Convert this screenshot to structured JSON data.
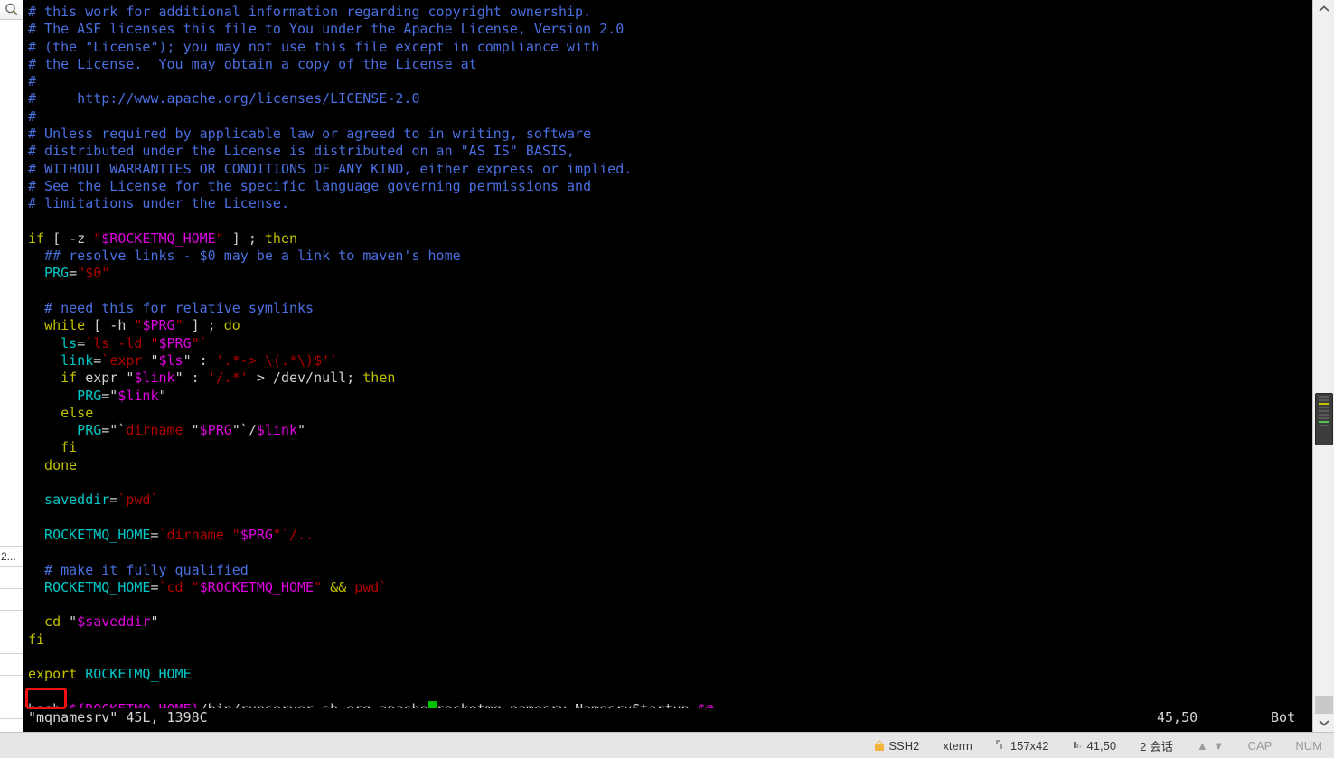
{
  "sidebar": {
    "search_icon": "magnifier-icon",
    "rows": [
      {
        "label": "2..."
      },
      {
        "label": ""
      },
      {
        "label": ""
      },
      {
        "label": ""
      },
      {
        "label": ""
      },
      {
        "label": ""
      },
      {
        "label": ""
      },
      {
        "label": ""
      }
    ]
  },
  "terminal": {
    "lines": [
      {
        "segs": [
          {
            "t": "# this work for additional information regarding copyright ownership.",
            "c": "c-comment"
          }
        ]
      },
      {
        "segs": [
          {
            "t": "# The ASF licenses this file to You under the Apache License, Version 2.0",
            "c": "c-comment"
          }
        ]
      },
      {
        "segs": [
          {
            "t": "# (the \"License\"); you may not use this file except in compliance with",
            "c": "c-comment"
          }
        ]
      },
      {
        "segs": [
          {
            "t": "# the License.  You may obtain a copy of the License at",
            "c": "c-comment"
          }
        ]
      },
      {
        "segs": [
          {
            "t": "#",
            "c": "c-comment"
          }
        ]
      },
      {
        "segs": [
          {
            "t": "#     http://www.apache.org/licenses/LICENSE-2.0",
            "c": "c-comment"
          }
        ]
      },
      {
        "segs": [
          {
            "t": "#",
            "c": "c-comment"
          }
        ]
      },
      {
        "segs": [
          {
            "t": "# Unless required by applicable law or agreed to in writing, software",
            "c": "c-comment"
          }
        ]
      },
      {
        "segs": [
          {
            "t": "# distributed under the License is distributed on an \"AS IS\" BASIS,",
            "c": "c-comment"
          }
        ]
      },
      {
        "segs": [
          {
            "t": "# WITHOUT WARRANTIES OR CONDITIONS OF ANY KIND, either express or implied.",
            "c": "c-comment"
          }
        ]
      },
      {
        "segs": [
          {
            "t": "# See the License for the specific language governing permissions and",
            "c": "c-comment"
          }
        ]
      },
      {
        "segs": [
          {
            "t": "# limitations under the License.",
            "c": "c-comment"
          }
        ]
      },
      {
        "segs": [
          {
            "t": "",
            "c": "c-plain"
          }
        ]
      },
      {
        "segs": [
          {
            "t": "if",
            "c": "c-keyword"
          },
          {
            "t": " [ -z ",
            "c": "c-plain"
          },
          {
            "t": "\"",
            "c": "c-str"
          },
          {
            "t": "$ROCKETMQ_HOME",
            "c": "c-var"
          },
          {
            "t": "\"",
            "c": "c-str"
          },
          {
            "t": " ] ; ",
            "c": "c-plain"
          },
          {
            "t": "then",
            "c": "c-keyword"
          }
        ]
      },
      {
        "segs": [
          {
            "t": "  ## resolve links - $0 may be a link to maven's home",
            "c": "c-comment"
          }
        ]
      },
      {
        "segs": [
          {
            "t": "  PRG",
            "c": "c-ident"
          },
          {
            "t": "=",
            "c": "c-plain"
          },
          {
            "t": "\"",
            "c": "c-str"
          },
          {
            "t": "$0",
            "c": "c-str"
          },
          {
            "t": "\"",
            "c": "c-str"
          }
        ]
      },
      {
        "segs": [
          {
            "t": "",
            "c": "c-plain"
          }
        ]
      },
      {
        "segs": [
          {
            "t": "  # need this for relative symlinks",
            "c": "c-comment"
          }
        ]
      },
      {
        "segs": [
          {
            "t": "  while",
            "c": "c-keyword"
          },
          {
            "t": " [ -h ",
            "c": "c-plain"
          },
          {
            "t": "\"",
            "c": "c-str"
          },
          {
            "t": "$PRG",
            "c": "c-var"
          },
          {
            "t": "\"",
            "c": "c-str"
          },
          {
            "t": " ] ; ",
            "c": "c-plain"
          },
          {
            "t": "do",
            "c": "c-keyword"
          }
        ]
      },
      {
        "segs": [
          {
            "t": "    ls",
            "c": "c-ident"
          },
          {
            "t": "=",
            "c": "c-plain"
          },
          {
            "t": "`ls -ld ",
            "c": "c-str"
          },
          {
            "t": "\"",
            "c": "c-str"
          },
          {
            "t": "$PRG",
            "c": "c-var"
          },
          {
            "t": "\"`",
            "c": "c-str"
          }
        ]
      },
      {
        "segs": [
          {
            "t": "    link",
            "c": "c-ident"
          },
          {
            "t": "=",
            "c": "c-plain"
          },
          {
            "t": "`",
            "c": "c-str"
          },
          {
            "t": "expr",
            "c": "c-str"
          },
          {
            "t": " \"",
            "c": "c-plain"
          },
          {
            "t": "$ls",
            "c": "c-var"
          },
          {
            "t": "\" : ",
            "c": "c-plain"
          },
          {
            "t": "'.*-> \\(.*\\)$'`",
            "c": "c-str"
          }
        ]
      },
      {
        "segs": [
          {
            "t": "    if",
            "c": "c-keyword"
          },
          {
            "t": " expr \"",
            "c": "c-plain"
          },
          {
            "t": "$link",
            "c": "c-var"
          },
          {
            "t": "\" : ",
            "c": "c-plain"
          },
          {
            "t": "'/.*'",
            "c": "c-str"
          },
          {
            "t": " > /dev/null; ",
            "c": "c-plain"
          },
          {
            "t": "then",
            "c": "c-keyword"
          }
        ]
      },
      {
        "segs": [
          {
            "t": "      PRG",
            "c": "c-ident"
          },
          {
            "t": "=\"",
            "c": "c-plain"
          },
          {
            "t": "$link",
            "c": "c-var"
          },
          {
            "t": "\"",
            "c": "c-plain"
          }
        ]
      },
      {
        "segs": [
          {
            "t": "    else",
            "c": "c-keyword"
          }
        ]
      },
      {
        "segs": [
          {
            "t": "      PRG",
            "c": "c-ident"
          },
          {
            "t": "=\"`",
            "c": "c-plain"
          },
          {
            "t": "dirname",
            "c": "c-str"
          },
          {
            "t": " \"",
            "c": "c-plain"
          },
          {
            "t": "$PRG",
            "c": "c-var"
          },
          {
            "t": "\"`/",
            "c": "c-plain"
          },
          {
            "t": "$link",
            "c": "c-var"
          },
          {
            "t": "\"",
            "c": "c-plain"
          }
        ]
      },
      {
        "segs": [
          {
            "t": "    fi",
            "c": "c-keyword"
          }
        ]
      },
      {
        "segs": [
          {
            "t": "  done",
            "c": "c-keyword"
          }
        ]
      },
      {
        "segs": [
          {
            "t": "",
            "c": "c-plain"
          }
        ]
      },
      {
        "segs": [
          {
            "t": "  saveddir",
            "c": "c-ident"
          },
          {
            "t": "=",
            "c": "c-plain"
          },
          {
            "t": "`pwd`",
            "c": "c-str"
          }
        ]
      },
      {
        "segs": [
          {
            "t": "",
            "c": "c-plain"
          }
        ]
      },
      {
        "segs": [
          {
            "t": "  ROCKETMQ_HOME",
            "c": "c-ident"
          },
          {
            "t": "=",
            "c": "c-plain"
          },
          {
            "t": "`dirname ",
            "c": "c-str"
          },
          {
            "t": "\"",
            "c": "c-str"
          },
          {
            "t": "$PRG",
            "c": "c-var"
          },
          {
            "t": "\"`",
            "c": "c-str"
          },
          {
            "t": "/..",
            "c": "c-str"
          }
        ]
      },
      {
        "segs": [
          {
            "t": "",
            "c": "c-plain"
          }
        ]
      },
      {
        "segs": [
          {
            "t": "  # make it fully qualified",
            "c": "c-comment"
          }
        ]
      },
      {
        "segs": [
          {
            "t": "  ROCKETMQ_HOME",
            "c": "c-ident"
          },
          {
            "t": "=",
            "c": "c-plain"
          },
          {
            "t": "`cd ",
            "c": "c-str"
          },
          {
            "t": "\"",
            "c": "c-str"
          },
          {
            "t": "$ROCKETMQ_HOME",
            "c": "c-var"
          },
          {
            "t": "\"",
            "c": "c-str"
          },
          {
            "t": " && ",
            "c": "c-keyword"
          },
          {
            "t": "pwd`",
            "c": "c-str"
          }
        ]
      },
      {
        "segs": [
          {
            "t": "",
            "c": "c-plain"
          }
        ]
      },
      {
        "segs": [
          {
            "t": "  cd",
            "c": "c-keyword"
          },
          {
            "t": " \"",
            "c": "c-plain"
          },
          {
            "t": "$saveddir",
            "c": "c-var"
          },
          {
            "t": "\"",
            "c": "c-plain"
          }
        ]
      },
      {
        "segs": [
          {
            "t": "fi",
            "c": "c-keyword"
          }
        ]
      },
      {
        "segs": [
          {
            "t": "",
            "c": "c-plain"
          }
        ]
      },
      {
        "segs": [
          {
            "t": "export",
            "c": "c-keyword"
          },
          {
            "t": " ",
            "c": "c-plain"
          },
          {
            "t": "ROCKETMQ_HOME",
            "c": "c-ident"
          }
        ]
      },
      {
        "segs": [
          {
            "t": "",
            "c": "c-plain"
          }
        ]
      },
      {
        "segs": [
          {
            "t": "bash",
            "c": "c-plain"
          },
          {
            "t": " ",
            "c": "c-plain"
          },
          {
            "t": "${ROCKETMQ_HOME}",
            "c": "c-var"
          },
          {
            "t": "/bin/runserver.sh org.apache",
            "c": "c-plain"
          },
          {
            "t": ".",
            "c": "cursor"
          },
          {
            "t": "rocketmq.namesrv.NamesrvStartup ",
            "c": "c-plain"
          },
          {
            "t": "$@",
            "c": "c-var"
          }
        ]
      }
    ],
    "status": {
      "file_info": "\"mqnamesrv\" 45L, 1398C",
      "position": "45,50",
      "location": "Bot"
    },
    "annotation": {
      "label": "bash-highlight-box",
      "color": "#f01010"
    }
  },
  "scrollbar": {
    "up_arrow": "chevron-up-icon",
    "down_arrow": "chevron-down-icon"
  },
  "statusbar": {
    "protocol": "SSH2",
    "terminal_type": "xterm",
    "size_icon": "screen-size-icon",
    "size": "157x42",
    "cursor_icon": "cursor-position-icon",
    "cursor": "41,50",
    "sessions": "2 会话",
    "arrow_up": "▲",
    "arrow_down": "▼",
    "cap": "CAP",
    "num": "NUM"
  }
}
